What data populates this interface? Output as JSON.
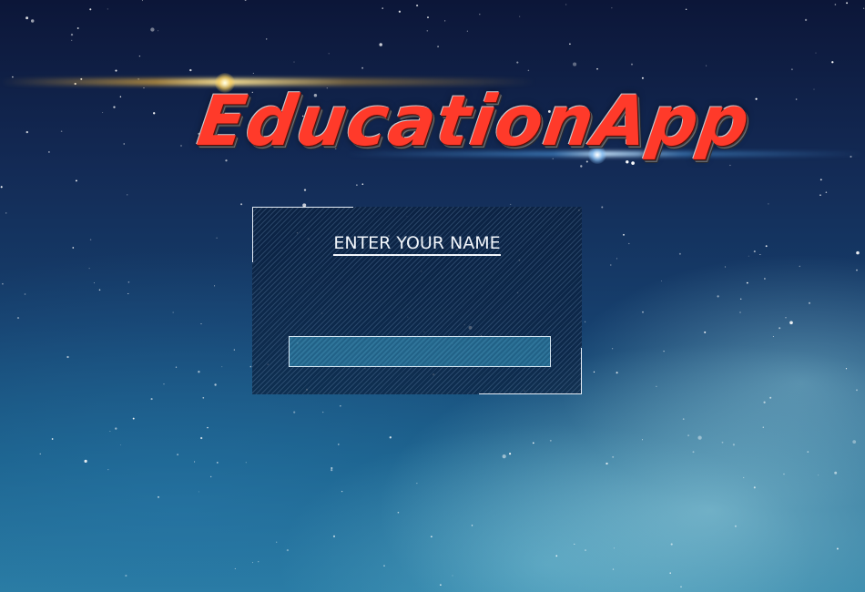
{
  "app": {
    "logo_text": "EducationApp"
  },
  "login_panel": {
    "title": "ENTER YOUR NAME",
    "name_input": {
      "value": "",
      "placeholder": ""
    }
  },
  "colors": {
    "logo_red": "#ff3a2a",
    "panel_border": "#e6eef7",
    "input_fill": "#3ca0c8"
  }
}
